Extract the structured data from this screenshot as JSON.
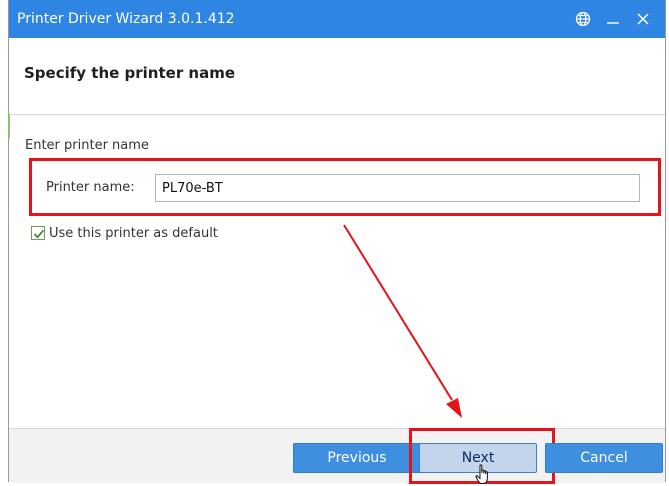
{
  "window": {
    "title": "Printer Driver Wizard  3.0.1.412",
    "controls": [
      "globe-icon",
      "minimize-icon",
      "close-icon"
    ]
  },
  "header": {
    "title": "Specify the printer name"
  },
  "form": {
    "section_label": "Enter printer name",
    "printer_name_label": "Printer name:",
    "printer_name_value": "PL70e-BT",
    "default_checkbox_label": "Use this printer as default",
    "default_checked": true
  },
  "footer": {
    "previous_label": "Previous",
    "next_label": "Next",
    "cancel_label": "Cancel"
  },
  "colors": {
    "titlebar": "#2f86e2",
    "annotation": "#e5141b",
    "button_primary": "#3f8fe0",
    "button_focused": "#c3d5ea"
  }
}
